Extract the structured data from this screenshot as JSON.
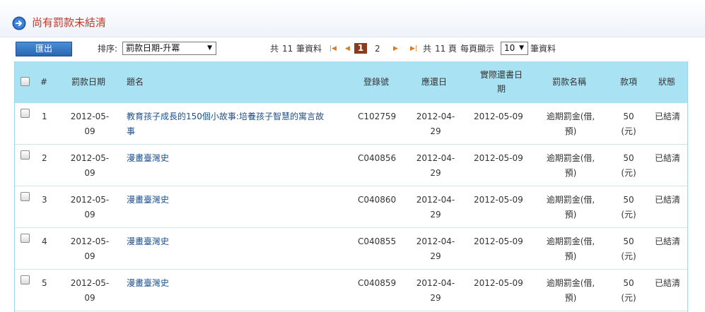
{
  "header": {
    "title": "尚有罰款未結清"
  },
  "toolbar": {
    "export_label": "匯出",
    "sort_label": "排序:",
    "sort_value": "罰款日期-升冪"
  },
  "pager": {
    "total_prefix": "共",
    "total_records": "11",
    "records_suffix": "筆資料",
    "current_page": "1",
    "other_page": "2",
    "pages_prefix": "共",
    "total_pages": "11",
    "pages_suffix": "頁",
    "per_page_label": "每頁顯示",
    "per_page_value": "10",
    "per_page_suffix": "筆資料"
  },
  "table": {
    "headers": {
      "num": "#",
      "fine_date": "罰款日期",
      "title": "題名",
      "barcode": "登錄號",
      "due_date": "應還日",
      "return_date_1": "實際還書日",
      "return_date_2": "期",
      "fine_name": "罰款名稱",
      "amount": "款項",
      "status": "狀態"
    },
    "rows": [
      {
        "num": "1",
        "fine_date_1": "2012-05-",
        "fine_date_2": "09",
        "title_1": "教育孩子成長的150個小故事:培養孩子智慧的寓言故",
        "title_2": "事",
        "barcode": "C102759",
        "due_1": "2012-04-",
        "due_2": "29",
        "returned": "2012-05-09",
        "fine_name_1": "逾期罰金(借,",
        "fine_name_2": "預)",
        "amount_1": "50",
        "amount_2": "(元)",
        "status": "已結清"
      },
      {
        "num": "2",
        "fine_date_1": "2012-05-",
        "fine_date_2": "09",
        "title_1": "漫畫臺灣史",
        "title_2": "",
        "barcode": "C040856",
        "due_1": "2012-04-",
        "due_2": "29",
        "returned": "2012-05-09",
        "fine_name_1": "逾期罰金(借,",
        "fine_name_2": "預)",
        "amount_1": "50",
        "amount_2": "(元)",
        "status": "已結清"
      },
      {
        "num": "3",
        "fine_date_1": "2012-05-",
        "fine_date_2": "09",
        "title_1": "漫畫臺灣史",
        "title_2": "",
        "barcode": "C040860",
        "due_1": "2012-04-",
        "due_2": "29",
        "returned": "2012-05-09",
        "fine_name_1": "逾期罰金(借,",
        "fine_name_2": "預)",
        "amount_1": "50",
        "amount_2": "(元)",
        "status": "已結清"
      },
      {
        "num": "4",
        "fine_date_1": "2012-05-",
        "fine_date_2": "09",
        "title_1": "漫畫臺灣史",
        "title_2": "",
        "barcode": "C040855",
        "due_1": "2012-04-",
        "due_2": "29",
        "returned": "2012-05-09",
        "fine_name_1": "逾期罰金(借,",
        "fine_name_2": "預)",
        "amount_1": "50",
        "amount_2": "(元)",
        "status": "已結清"
      },
      {
        "num": "5",
        "fine_date_1": "2012-05-",
        "fine_date_2": "09",
        "title_1": "漫畫臺灣史",
        "title_2": "",
        "barcode": "C040859",
        "due_1": "2012-04-",
        "due_2": "29",
        "returned": "2012-05-09",
        "fine_name_1": "逾期罰金(借,",
        "fine_name_2": "預)",
        "amount_1": "50",
        "amount_2": "(元)",
        "status": "已結清"
      }
    ]
  },
  "icons": {
    "title_icon": "arrow-right-circle-icon",
    "first": "first-page-icon",
    "prev": "prev-page-icon",
    "next": "next-page-icon",
    "last": "last-page-icon"
  },
  "colors": {
    "accent_red": "#c0392b",
    "header_blue": "#a9e3f3",
    "button_blue": "#2a66b2",
    "link_blue": "#1a4f8b"
  }
}
